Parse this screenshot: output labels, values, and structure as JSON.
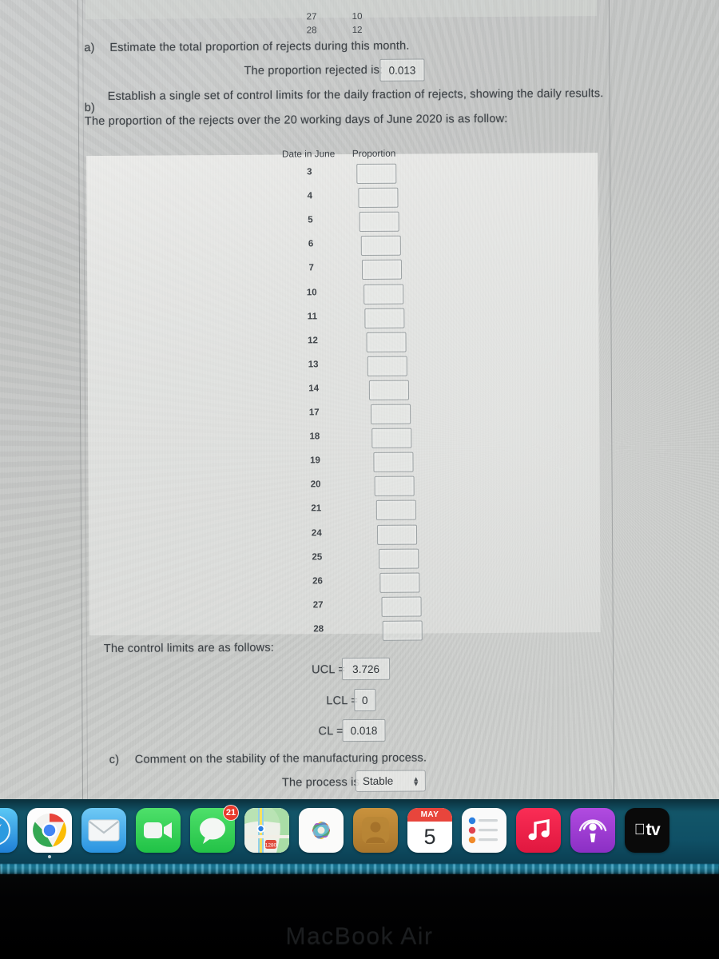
{
  "document": {
    "top_table": {
      "rows": [
        {
          "date": "27",
          "value": "10"
        },
        {
          "date": "28",
          "value": "12"
        }
      ]
    },
    "question_a": {
      "marker": "a)",
      "text": "Estimate the total proportion of rejects during this month.",
      "answer_label": "The proportion rejected is:",
      "answer_value": "0.013"
    },
    "question_b": {
      "marker": "b)",
      "text": "Establish a single set of control limits for the daily fraction of rejects, showing the daily results.",
      "subtext": "The proportion of the rejects over the 20 working days of June 2020 is as follow:",
      "table": {
        "headers": [
          "Date in June",
          "Proportion"
        ],
        "dates": [
          "3",
          "4",
          "5",
          "6",
          "7",
          "10",
          "11",
          "12",
          "13",
          "14",
          "17",
          "18",
          "19",
          "20",
          "21",
          "24",
          "25",
          "26",
          "27",
          "28"
        ],
        "proportions": [
          "",
          "",
          "",
          "",
          "",
          "",
          "",
          "",
          "",
          "",
          "",
          "",
          "",
          "",
          "",
          "",
          "",
          "",
          "",
          ""
        ]
      },
      "limits_intro": "The control limits are as follows:",
      "limits": [
        {
          "label": "UCL =",
          "value": "3.726"
        },
        {
          "label": "LCL =",
          "value": "0"
        },
        {
          "label": "CL =",
          "value": "0.018"
        }
      ]
    },
    "question_c": {
      "marker": "c)",
      "text": "Comment on the stability of the manufacturing process.",
      "answer_label": "The process is",
      "answer_value": "Stable"
    }
  },
  "dock": {
    "items": [
      {
        "name": "safari",
        "label": "Safari",
        "badge": "",
        "running": false
      },
      {
        "name": "chrome",
        "label": "Chrome",
        "badge": "",
        "running": true
      },
      {
        "name": "mail",
        "label": "Mail",
        "badge": "",
        "running": false
      },
      {
        "name": "facetime",
        "label": "FaceTime",
        "badge": "",
        "running": false
      },
      {
        "name": "messages",
        "label": "Messages",
        "badge": "21",
        "running": false
      },
      {
        "name": "maps",
        "label": "Maps",
        "badge": "",
        "running": false
      },
      {
        "name": "photos",
        "label": "Photos",
        "badge": "",
        "running": false
      },
      {
        "name": "contacts",
        "label": "Contacts",
        "badge": "",
        "running": false
      },
      {
        "name": "calendar",
        "label": "Calendar",
        "badge": "",
        "running": false,
        "month": "MAY",
        "day": "5"
      },
      {
        "name": "reminders",
        "label": "Reminders",
        "badge": "",
        "running": false
      },
      {
        "name": "music",
        "label": "Music",
        "badge": "",
        "running": false
      },
      {
        "name": "podcasts",
        "label": "Podcasts",
        "badge": "",
        "running": false
      },
      {
        "name": "appletv",
        "label": "TV",
        "badge": "",
        "running": false
      }
    ]
  },
  "hardware": {
    "brand_label": "MacBook Air"
  },
  "colors": {
    "dock_background": "#0f5066",
    "badge_red": "#e8392b",
    "screen_paper": "#c8caca",
    "text": "#3c4145",
    "reflection_teal": "#2aa6cb"
  }
}
